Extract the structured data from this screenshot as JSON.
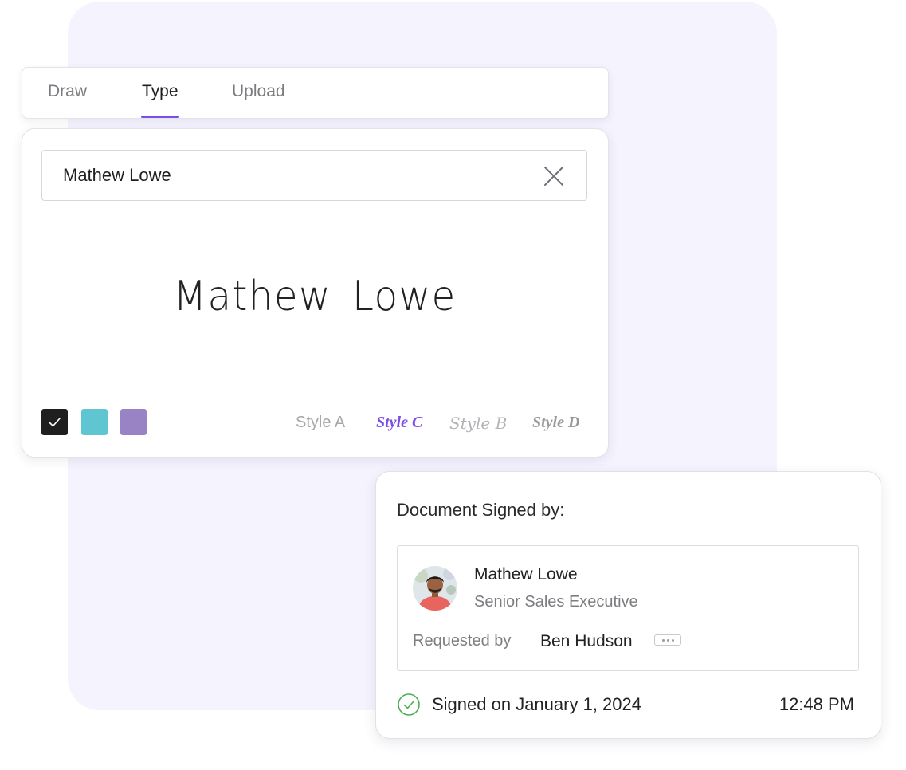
{
  "colors": {
    "accent": "#7b4fe6",
    "background_panel": "#f4f3fe",
    "success": "#4caf50"
  },
  "tabs": [
    {
      "label": "Draw",
      "active": false
    },
    {
      "label": "Type",
      "active": true
    },
    {
      "label": "Upload",
      "active": false
    }
  ],
  "signature": {
    "input_value": "Mathew Lowe",
    "preview_text": "Mathew Lowe",
    "clear_icon": "close-icon",
    "colors": [
      {
        "name": "black",
        "hex": "#1f1f1f",
        "selected": true
      },
      {
        "name": "teal",
        "hex": "#5fc5d1",
        "selected": false
      },
      {
        "name": "purple",
        "hex": "#9a83c5",
        "selected": false
      }
    ],
    "styles": [
      {
        "label": "Style A",
        "selected": false
      },
      {
        "label": "Style C",
        "selected": true
      },
      {
        "label": "Style B",
        "selected": false
      },
      {
        "label": "Style D",
        "selected": false
      }
    ]
  },
  "document": {
    "title": "Document Signed by:",
    "signer_name": "Mathew Lowe",
    "signer_role": "Senior Sales Executive",
    "requested_label": "Requested by",
    "requested_by": "Ben Hudson",
    "more_icon": "more-dots-icon",
    "status_icon": "check-circle-icon",
    "signed_on": "Signed on January 1, 2024",
    "time": "12:48 PM"
  }
}
